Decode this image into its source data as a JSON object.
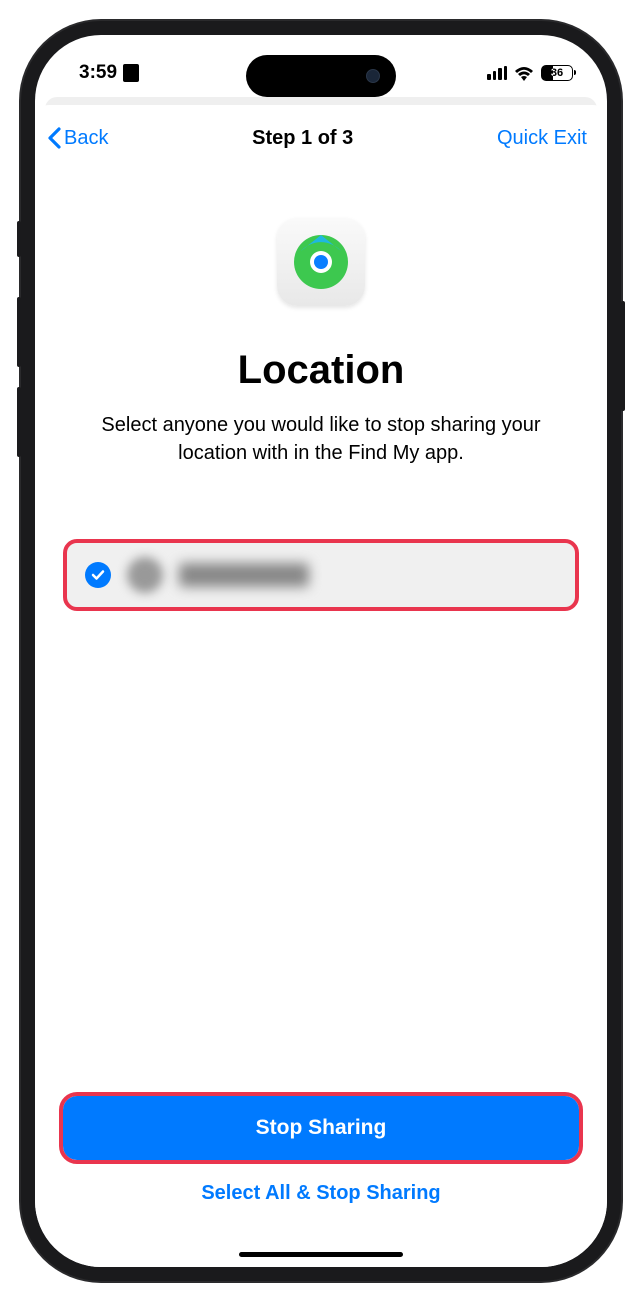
{
  "status_bar": {
    "time": "3:59",
    "battery_percent": "36"
  },
  "nav": {
    "back_label": "Back",
    "title": "Step 1 of 3",
    "quick_exit_label": "Quick Exit"
  },
  "main": {
    "title": "Location",
    "description": "Select anyone you would like to stop sharing your location with in the Find My app."
  },
  "people": [
    {
      "selected": true,
      "name_redacted": true
    }
  ],
  "actions": {
    "primary_label": "Stop Sharing",
    "secondary_label": "Select All & Stop Sharing"
  }
}
